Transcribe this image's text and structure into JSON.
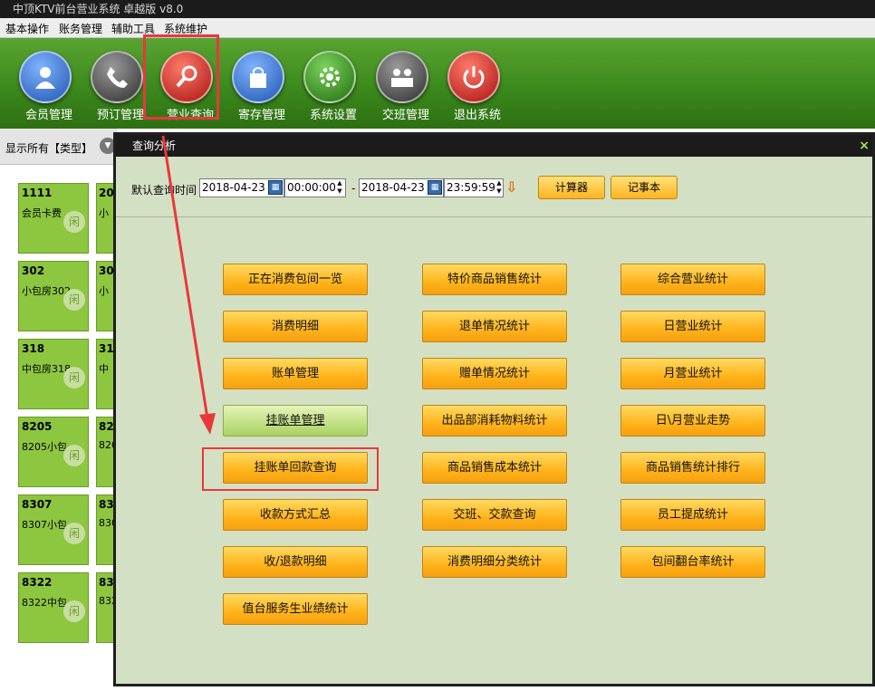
{
  "window": {
    "title": "中顶KTV前台营业系统 卓越版 v8.0"
  },
  "menu": [
    "基本操作",
    "账务管理",
    "辅助工具",
    "系统维护"
  ],
  "toolbar": [
    {
      "label": "会员管理",
      "icon": "member-icon",
      "color": "#2f6fc7"
    },
    {
      "label": "预订管理",
      "icon": "phone-icon",
      "color": "#4a4a4a"
    },
    {
      "label": "营业查询",
      "icon": "magnifier-icon",
      "color": "#c0231f"
    },
    {
      "label": "寄存管理",
      "icon": "bag-icon",
      "color": "#2f6fc7"
    },
    {
      "label": "系统设置",
      "icon": "gear-icon",
      "color": "#3f8a2a"
    },
    {
      "label": "交班管理",
      "icon": "people-icon",
      "color": "#4a4a4a"
    },
    {
      "label": "退出系统",
      "icon": "power-icon",
      "color": "#c0231f"
    }
  ],
  "filter": {
    "label": "显示所有【类型】"
  },
  "rooms": [
    {
      "no": "1111",
      "name": "会员卡费"
    },
    {
      "no": "302",
      "name": "小包房302"
    },
    {
      "no": "318",
      "name": "中包房318"
    },
    {
      "no": "8205",
      "name": "8205小包"
    },
    {
      "no": "8307",
      "name": "8307小包"
    },
    {
      "no": "8322",
      "name": "8322中包"
    }
  ],
  "rooms_partial": [
    {
      "no": "20",
      "name": "小"
    },
    {
      "no": "30",
      "name": "小"
    },
    {
      "no": "31",
      "name": "中"
    },
    {
      "no": "82",
      "name": "820"
    },
    {
      "no": "83",
      "name": "830"
    },
    {
      "no": "83",
      "name": "832"
    }
  ],
  "dialog": {
    "title": "查询分析",
    "close": "×",
    "query_label": "默认查询时间",
    "start_date": "2018-04-23",
    "start_time": "00:00:00",
    "separator": "-",
    "end_date": "2018-04-23",
    "end_time": "23:59:59",
    "calculator": "计算器",
    "notepad": "记事本",
    "buttons_col1": [
      "正在消费包间一览",
      "消费明细",
      "账单管理",
      "挂账单管理",
      "挂账单回款查询",
      "收款方式汇总",
      "收/退款明细",
      "值台服务生业绩统计"
    ],
    "buttons_col2": [
      "特价商品销售统计",
      "退单情况统计",
      "赠单情况统计",
      "出品部消耗物料统计",
      "商品销售成本统计",
      "交班、交款查询",
      "消费明细分类统计"
    ],
    "buttons_col3": [
      "综合营业统计",
      "日营业统计",
      "月营业统计",
      "日\\月营业走势",
      "商品销售统计排行",
      "员工提成统计",
      "包间翻台率统计"
    ]
  }
}
